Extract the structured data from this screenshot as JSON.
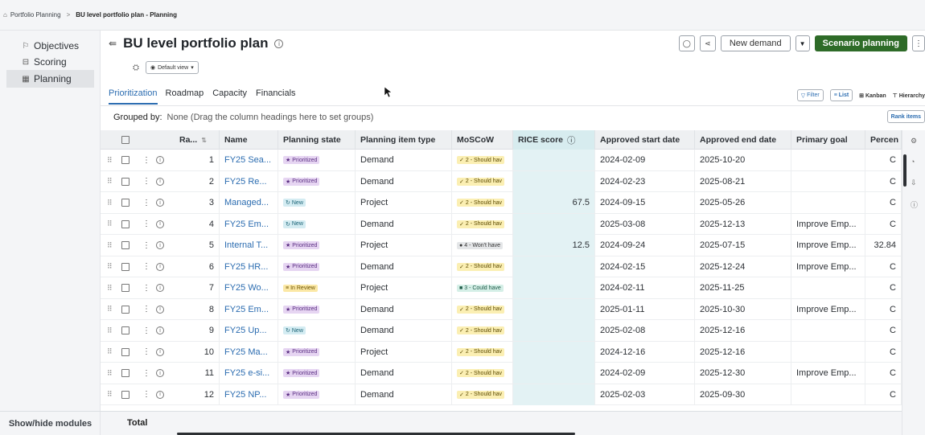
{
  "breadcrumb": {
    "root": "Portfolio Planning",
    "separator": ">",
    "current": "BU level portfolio plan - Planning"
  },
  "sidebar": {
    "items": [
      {
        "label": "Objectives",
        "icon": "flag-icon",
        "glyph": "⚐"
      },
      {
        "label": "Scoring",
        "icon": "scoring-icon",
        "glyph": "⊟"
      },
      {
        "label": "Planning",
        "icon": "planning-icon",
        "glyph": "▦"
      }
    ],
    "active": "Planning",
    "footer": "Show/hide modules"
  },
  "header": {
    "title": "BU level portfolio plan",
    "view_label": "Default view",
    "new_demand": "New demand",
    "scenario": "Scenario planning"
  },
  "tabs": [
    "Prioritization",
    "Roadmap",
    "Capacity",
    "Financials"
  ],
  "active_tab": "Prioritization",
  "view_tools": {
    "filter": "Filter",
    "list": "List",
    "kanban": "Kanban",
    "hierarchy": "Hierarchy"
  },
  "grouping": {
    "label": "Grouped by:",
    "value": "None (Drag the column headings here to set groups)"
  },
  "rank_items": "Rank items",
  "columns": [
    "Ra...",
    "Name",
    "Planning state",
    "Planning item type",
    "MoSCoW",
    "RICE score",
    "Approved start date",
    "Approved end date",
    "Primary goal",
    "Percen"
  ],
  "rows": [
    {
      "rank": "1",
      "name": "FY25 Sea...",
      "state": "Prioritized",
      "state_kind": "prioritized",
      "type": "Demand",
      "moscow": "2 - Should hav",
      "moscow_kind": "should",
      "rice": "",
      "start": "2024-02-09",
      "end": "2025-10-20",
      "goal": "",
      "pct": "C"
    },
    {
      "rank": "2",
      "name": "FY25 Re...",
      "state": "Prioritized",
      "state_kind": "prioritized",
      "type": "Demand",
      "moscow": "2 - Should hav",
      "moscow_kind": "should",
      "rice": "",
      "start": "2024-02-23",
      "end": "2025-08-21",
      "goal": "",
      "pct": "C"
    },
    {
      "rank": "3",
      "name": "Managed...",
      "state": "New",
      "state_kind": "new",
      "type": "Project",
      "moscow": "2 - Should hav",
      "moscow_kind": "should",
      "rice": "67.5",
      "start": "2024-09-15",
      "end": "2025-05-26",
      "goal": "",
      "pct": "C"
    },
    {
      "rank": "4",
      "name": "FY25 Em...",
      "state": "New",
      "state_kind": "new",
      "type": "Demand",
      "moscow": "2 - Should hav",
      "moscow_kind": "should",
      "rice": "",
      "start": "2025-03-08",
      "end": "2025-12-13",
      "goal": "Improve Emp...",
      "pct": "C"
    },
    {
      "rank": "5",
      "name": "Internal T...",
      "state": "Prioritized",
      "state_kind": "prioritized",
      "type": "Project",
      "moscow": "4 - Won't have",
      "moscow_kind": "wont",
      "rice": "12.5",
      "start": "2024-09-24",
      "end": "2025-07-15",
      "goal": "Improve Emp...",
      "pct": "32.84"
    },
    {
      "rank": "6",
      "name": "FY25 HR...",
      "state": "Prioritized",
      "state_kind": "prioritized",
      "type": "Demand",
      "moscow": "2 - Should hav",
      "moscow_kind": "should",
      "rice": "",
      "start": "2024-02-15",
      "end": "2025-12-24",
      "goal": "Improve Emp...",
      "pct": "C"
    },
    {
      "rank": "7",
      "name": "FY25 Wo...",
      "state": "In Review",
      "state_kind": "review",
      "type": "Project",
      "moscow": "3 - Could have",
      "moscow_kind": "could",
      "rice": "",
      "start": "2024-02-11",
      "end": "2025-11-25",
      "goal": "",
      "pct": "C"
    },
    {
      "rank": "8",
      "name": "FY25 Em...",
      "state": "Prioritized",
      "state_kind": "prioritized",
      "type": "Demand",
      "moscow": "2 - Should hav",
      "moscow_kind": "should",
      "rice": "",
      "start": "2025-01-11",
      "end": "2025-10-30",
      "goal": "Improve Emp...",
      "pct": "C"
    },
    {
      "rank": "9",
      "name": "FY25 Up...",
      "state": "New",
      "state_kind": "new",
      "type": "Demand",
      "moscow": "2 - Should hav",
      "moscow_kind": "should",
      "rice": "",
      "start": "2025-02-08",
      "end": "2025-12-16",
      "goal": "",
      "pct": "C"
    },
    {
      "rank": "10",
      "name": "FY25 Ma...",
      "state": "Prioritized",
      "state_kind": "prioritized",
      "type": "Project",
      "moscow": "2 - Should hav",
      "moscow_kind": "should",
      "rice": "",
      "start": "2024-12-16",
      "end": "2025-12-16",
      "goal": "",
      "pct": "C"
    },
    {
      "rank": "11",
      "name": "FY25 e-si...",
      "state": "Prioritized",
      "state_kind": "prioritized",
      "type": "Demand",
      "moscow": "2 - Should hav",
      "moscow_kind": "should",
      "rice": "",
      "start": "2024-02-09",
      "end": "2025-12-30",
      "goal": "Improve Emp...",
      "pct": "C"
    },
    {
      "rank": "12",
      "name": "FY25 NP...",
      "state": "Prioritized",
      "state_kind": "prioritized",
      "type": "Demand",
      "moscow": "2 - Should hav",
      "moscow_kind": "should",
      "rice": "",
      "start": "2025-02-03",
      "end": "2025-09-30",
      "goal": "",
      "pct": "C"
    }
  ],
  "total_label": "Total",
  "colors": {
    "accent": "#2b6cb0",
    "primary_button": "#2e6b28",
    "rice_column": "#d7ecef"
  }
}
